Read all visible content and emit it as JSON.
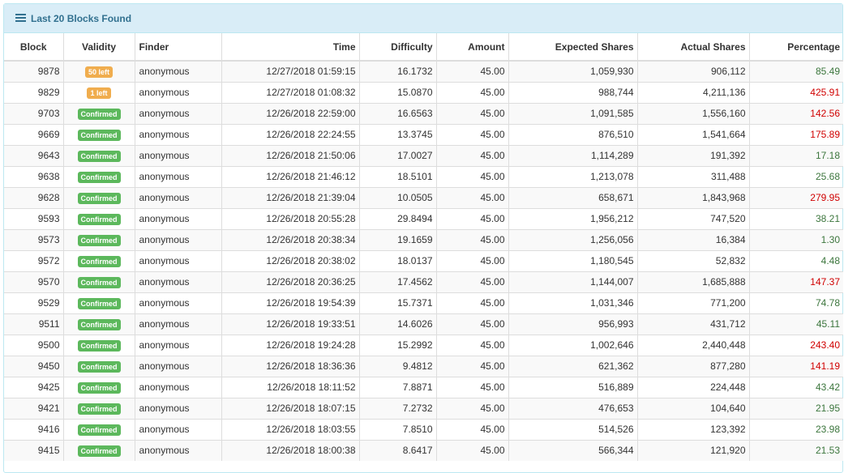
{
  "panel": {
    "title": "Last 20 Blocks Found",
    "icon": "list-icon"
  },
  "colors": {
    "heading_bg": "#d9edf7",
    "heading_text": "#31708f",
    "confirmed": "#5cb85c",
    "pending": "#f0ad4e",
    "good_percent": "#3c763d",
    "bad_percent": "#d00000"
  },
  "table": {
    "headers": {
      "block": "Block",
      "validity": "Validity",
      "finder": "Finder",
      "time": "Time",
      "difficulty": "Difficulty",
      "amount": "Amount",
      "expected": "Expected Shares",
      "actual": "Actual Shares",
      "percentage": "Percentage"
    },
    "rows": [
      {
        "block": "9878",
        "validity": "50 left",
        "status": "pending",
        "finder": "anonymous",
        "time": "12/27/2018 01:59:15",
        "difficulty": "16.1732",
        "amount": "45.00",
        "expected": "1,059,930",
        "actual": "906,112",
        "percentage": "85.49",
        "lucky": true
      },
      {
        "block": "9829",
        "validity": "1 left",
        "status": "pending",
        "finder": "anonymous",
        "time": "12/27/2018 01:08:32",
        "difficulty": "15.0870",
        "amount": "45.00",
        "expected": "988,744",
        "actual": "4,211,136",
        "percentage": "425.91",
        "lucky": false
      },
      {
        "block": "9703",
        "validity": "Confirmed",
        "status": "confirmed",
        "finder": "anonymous",
        "time": "12/26/2018 22:59:00",
        "difficulty": "16.6563",
        "amount": "45.00",
        "expected": "1,091,585",
        "actual": "1,556,160",
        "percentage": "142.56",
        "lucky": false
      },
      {
        "block": "9669",
        "validity": "Confirmed",
        "status": "confirmed",
        "finder": "anonymous",
        "time": "12/26/2018 22:24:55",
        "difficulty": "13.3745",
        "amount": "45.00",
        "expected": "876,510",
        "actual": "1,541,664",
        "percentage": "175.89",
        "lucky": false
      },
      {
        "block": "9643",
        "validity": "Confirmed",
        "status": "confirmed",
        "finder": "anonymous",
        "time": "12/26/2018 21:50:06",
        "difficulty": "17.0027",
        "amount": "45.00",
        "expected": "1,114,289",
        "actual": "191,392",
        "percentage": "17.18",
        "lucky": true
      },
      {
        "block": "9638",
        "validity": "Confirmed",
        "status": "confirmed",
        "finder": "anonymous",
        "time": "12/26/2018 21:46:12",
        "difficulty": "18.5101",
        "amount": "45.00",
        "expected": "1,213,078",
        "actual": "311,488",
        "percentage": "25.68",
        "lucky": true
      },
      {
        "block": "9628",
        "validity": "Confirmed",
        "status": "confirmed",
        "finder": "anonymous",
        "time": "12/26/2018 21:39:04",
        "difficulty": "10.0505",
        "amount": "45.00",
        "expected": "658,671",
        "actual": "1,843,968",
        "percentage": "279.95",
        "lucky": false
      },
      {
        "block": "9593",
        "validity": "Confirmed",
        "status": "confirmed",
        "finder": "anonymous",
        "time": "12/26/2018 20:55:28",
        "difficulty": "29.8494",
        "amount": "45.00",
        "expected": "1,956,212",
        "actual": "747,520",
        "percentage": "38.21",
        "lucky": true
      },
      {
        "block": "9573",
        "validity": "Confirmed",
        "status": "confirmed",
        "finder": "anonymous",
        "time": "12/26/2018 20:38:34",
        "difficulty": "19.1659",
        "amount": "45.00",
        "expected": "1,256,056",
        "actual": "16,384",
        "percentage": "1.30",
        "lucky": true
      },
      {
        "block": "9572",
        "validity": "Confirmed",
        "status": "confirmed",
        "finder": "anonymous",
        "time": "12/26/2018 20:38:02",
        "difficulty": "18.0137",
        "amount": "45.00",
        "expected": "1,180,545",
        "actual": "52,832",
        "percentage": "4.48",
        "lucky": true
      },
      {
        "block": "9570",
        "validity": "Confirmed",
        "status": "confirmed",
        "finder": "anonymous",
        "time": "12/26/2018 20:36:25",
        "difficulty": "17.4562",
        "amount": "45.00",
        "expected": "1,144,007",
        "actual": "1,685,888",
        "percentage": "147.37",
        "lucky": false
      },
      {
        "block": "9529",
        "validity": "Confirmed",
        "status": "confirmed",
        "finder": "anonymous",
        "time": "12/26/2018 19:54:39",
        "difficulty": "15.7371",
        "amount": "45.00",
        "expected": "1,031,346",
        "actual": "771,200",
        "percentage": "74.78",
        "lucky": true
      },
      {
        "block": "9511",
        "validity": "Confirmed",
        "status": "confirmed",
        "finder": "anonymous",
        "time": "12/26/2018 19:33:51",
        "difficulty": "14.6026",
        "amount": "45.00",
        "expected": "956,993",
        "actual": "431,712",
        "percentage": "45.11",
        "lucky": true
      },
      {
        "block": "9500",
        "validity": "Confirmed",
        "status": "confirmed",
        "finder": "anonymous",
        "time": "12/26/2018 19:24:28",
        "difficulty": "15.2992",
        "amount": "45.00",
        "expected": "1,002,646",
        "actual": "2,440,448",
        "percentage": "243.40",
        "lucky": false
      },
      {
        "block": "9450",
        "validity": "Confirmed",
        "status": "confirmed",
        "finder": "anonymous",
        "time": "12/26/2018 18:36:36",
        "difficulty": "9.4812",
        "amount": "45.00",
        "expected": "621,362",
        "actual": "877,280",
        "percentage": "141.19",
        "lucky": false
      },
      {
        "block": "9425",
        "validity": "Confirmed",
        "status": "confirmed",
        "finder": "anonymous",
        "time": "12/26/2018 18:11:52",
        "difficulty": "7.8871",
        "amount": "45.00",
        "expected": "516,889",
        "actual": "224,448",
        "percentage": "43.42",
        "lucky": true
      },
      {
        "block": "9421",
        "validity": "Confirmed",
        "status": "confirmed",
        "finder": "anonymous",
        "time": "12/26/2018 18:07:15",
        "difficulty": "7.2732",
        "amount": "45.00",
        "expected": "476,653",
        "actual": "104,640",
        "percentage": "21.95",
        "lucky": true
      },
      {
        "block": "9416",
        "validity": "Confirmed",
        "status": "confirmed",
        "finder": "anonymous",
        "time": "12/26/2018 18:03:55",
        "difficulty": "7.8510",
        "amount": "45.00",
        "expected": "514,526",
        "actual": "123,392",
        "percentage": "23.98",
        "lucky": true
      },
      {
        "block": "9415",
        "validity": "Confirmed",
        "status": "confirmed",
        "finder": "anonymous",
        "time": "12/26/2018 18:00:38",
        "difficulty": "8.6417",
        "amount": "45.00",
        "expected": "566,344",
        "actual": "121,920",
        "percentage": "21.53",
        "lucky": true
      }
    ]
  }
}
